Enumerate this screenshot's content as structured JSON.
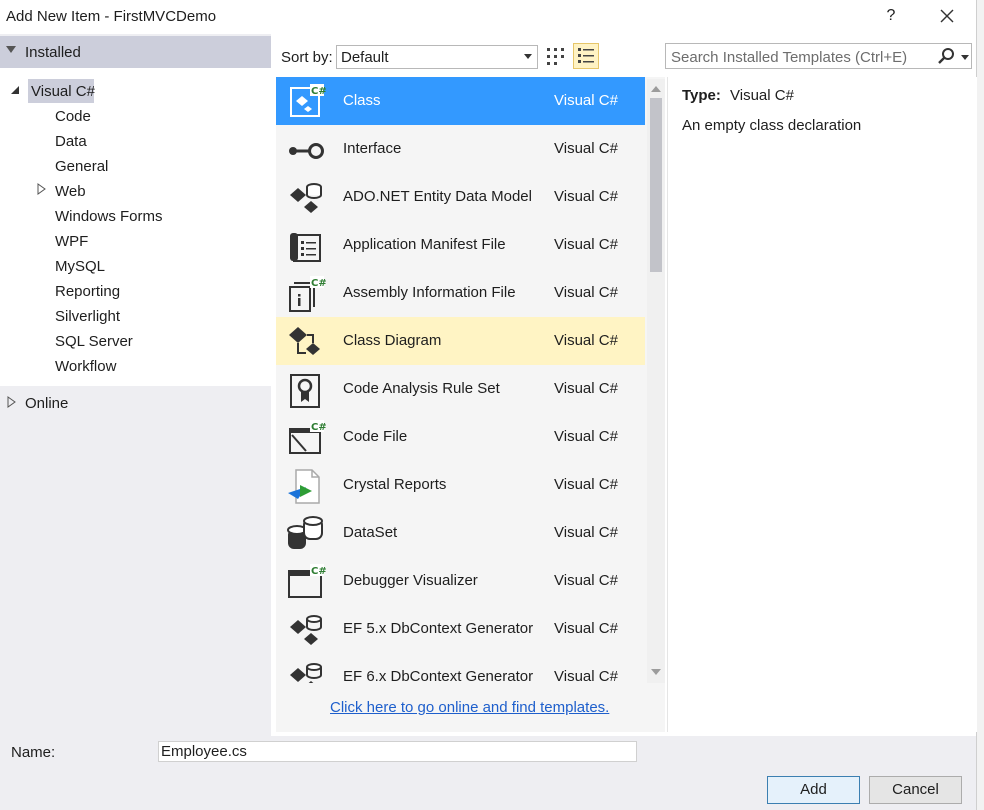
{
  "window": {
    "title": "Add New Item - FirstMVCDemo",
    "help_label": "?"
  },
  "left_panel": {
    "installed_label": "Installed",
    "selected_node": "Visual C#",
    "children": [
      "Code",
      "Data",
      "General",
      "Web",
      "Windows Forms",
      "WPF",
      "MySQL",
      "Reporting",
      "Silverlight",
      "SQL Server",
      "Workflow"
    ],
    "online_label": "Online"
  },
  "toolbar": {
    "sort_label": "Sort by:",
    "sort_value": "Default"
  },
  "search": {
    "placeholder": "Search Installed Templates (Ctrl+E)"
  },
  "templates": [
    {
      "name": "Class",
      "language": "Visual C#",
      "icon": "class-icon",
      "state": "selected"
    },
    {
      "name": "Interface",
      "language": "Visual C#",
      "icon": "interface-icon",
      "state": ""
    },
    {
      "name": "ADO.NET Entity Data Model",
      "language": "Visual C#",
      "icon": "entity-model-icon",
      "state": ""
    },
    {
      "name": "Application Manifest File",
      "language": "Visual C#",
      "icon": "manifest-icon",
      "state": ""
    },
    {
      "name": "Assembly Information File",
      "language": "Visual C#",
      "icon": "assembly-info-icon",
      "state": ""
    },
    {
      "name": "Class Diagram",
      "language": "Visual C#",
      "icon": "class-diagram-icon",
      "state": "hover"
    },
    {
      "name": "Code Analysis Rule Set",
      "language": "Visual C#",
      "icon": "rule-set-icon",
      "state": ""
    },
    {
      "name": "Code File",
      "language": "Visual C#",
      "icon": "code-file-icon",
      "state": ""
    },
    {
      "name": "Crystal Reports",
      "language": "Visual C#",
      "icon": "crystal-reports-icon",
      "state": ""
    },
    {
      "name": "DataSet",
      "language": "Visual C#",
      "icon": "dataset-icon",
      "state": ""
    },
    {
      "name": "Debugger Visualizer",
      "language": "Visual C#",
      "icon": "debugger-visualizer-icon",
      "state": ""
    },
    {
      "name": "EF 5.x DbContext Generator",
      "language": "Visual C#",
      "icon": "ef-generator-icon",
      "state": ""
    },
    {
      "name": "EF 6.x DbContext Generator",
      "language": "Visual C#",
      "icon": "ef-generator-icon",
      "state": ""
    }
  ],
  "online_link": "Click here to go online and find templates.",
  "details": {
    "type_label": "Type:",
    "type_value": "Visual C#",
    "description": "An empty class declaration"
  },
  "footer": {
    "name_label": "Name:",
    "name_value": "Employee.cs",
    "add_label": "Add",
    "cancel_label": "Cancel"
  },
  "colors": {
    "selection": "#3399ff",
    "hover": "#fff4c4",
    "link": "#1e5fcc",
    "panel": "#eeeef2"
  }
}
